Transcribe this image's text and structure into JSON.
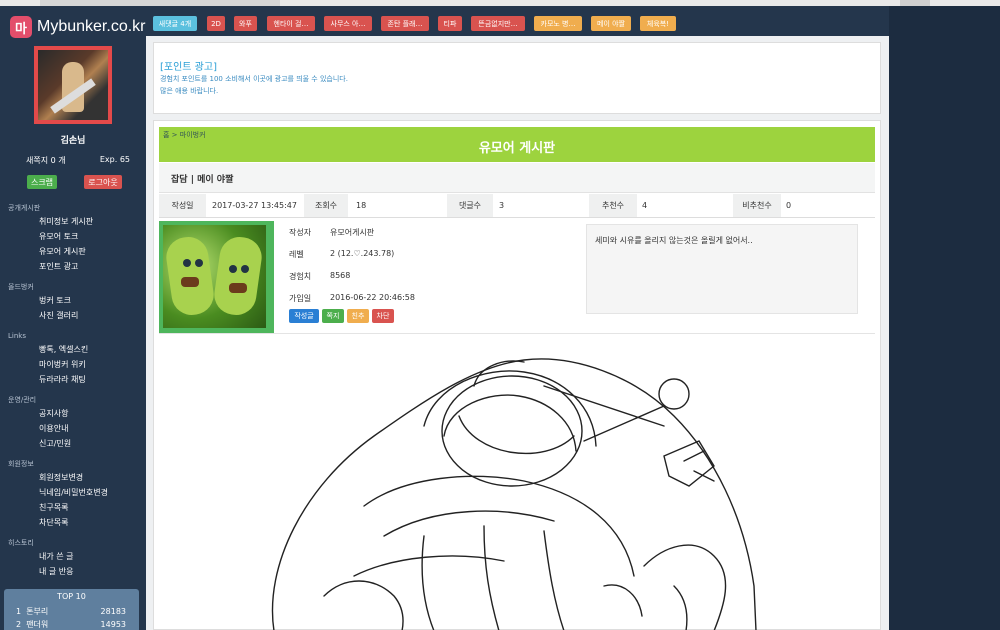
{
  "site": {
    "logo_badge": "마",
    "logo_text": "Mybunker.co.kr"
  },
  "user": {
    "name": "김손님",
    "messages": "새쪽지 0 개",
    "exp": "Exp. 65",
    "scrap_label": "스크랩",
    "logout_label": "로그아웃"
  },
  "menu": {
    "sections": [
      {
        "title": "공개게시판",
        "items": [
          "취미정보 게시판",
          "유모어 토크",
          "유모어 게시판",
          "포인트 광고"
        ]
      },
      {
        "title": "올드벙커",
        "items": [
          "벙커 토크",
          "사진 갤러리"
        ]
      },
      {
        "title": "Links",
        "items": [
          "빵톡, 엑셀스킨",
          "마이벙커 위키",
          "듀라라라 채팅"
        ]
      },
      {
        "title": "운영/관리",
        "items": [
          "공지사항",
          "이용안내",
          "신고/민원"
        ]
      },
      {
        "title": "회원정보",
        "items": [
          "회원정보변경",
          "닉네임/비밀번호변경",
          "친구목록",
          "차단목록"
        ]
      },
      {
        "title": "히스토리",
        "items": [
          "내가 쓴 글",
          "내 글 반응"
        ]
      }
    ]
  },
  "top10": {
    "title": "TOP 10",
    "rows": [
      {
        "rank": "1",
        "name": "톤부리",
        "score": "28183"
      },
      {
        "rank": "2",
        "name": "팬더워",
        "score": "14953"
      }
    ]
  },
  "topbar": {
    "chips": [
      {
        "label": "새댓글 4개",
        "color": "#5bc0de"
      },
      {
        "label": "2D",
        "color": "#d9534f"
      },
      {
        "label": "와푸",
        "color": "#d9534f"
      },
      {
        "label": "헨타이 걸…",
        "color": "#d9534f"
      },
      {
        "label": "사무스 아…",
        "color": "#d9534f"
      },
      {
        "label": "존탄 플래…",
        "color": "#d9534f"
      },
      {
        "label": "티파",
        "color": "#d9534f"
      },
      {
        "label": "뜬금없지만…",
        "color": "#d9534f"
      },
      {
        "label": "카모노 병…",
        "color": "#f0ad4e"
      },
      {
        "label": "메이 야짤",
        "color": "#f0ad4e"
      },
      {
        "label": "체육복!",
        "color": "#f0ad4e"
      }
    ]
  },
  "ad": {
    "title": "[포인트 광고]",
    "line1": "경험치 포인트를 100 소비해서 이곳에 광고를 띄울 수 있습니다.",
    "line2": "많은 애용 바랍니다."
  },
  "board": {
    "breadcrumb": "홈 > 마이벙커",
    "title": "유모어 게시판"
  },
  "post": {
    "title": "잡담 | 메이 야짤",
    "info": {
      "date_label": "작성일",
      "date": "2017-03-27 13:45:47",
      "views_label": "조회수",
      "views": "18",
      "comments_label": "댓글수",
      "comments": "3",
      "up_label": "추천수",
      "up": "4",
      "down_label": "비추천수",
      "down": "0"
    },
    "author": {
      "writer_label": "작성자",
      "writer": "유모어게시판",
      "level_label": "레벨",
      "level": "2 (12.♡.243.78)",
      "exp_label": "경험치",
      "exp": "8568",
      "joined_label": "가입일",
      "joined": "2016-06-22 20:46:58"
    },
    "actions": {
      "posts": "작성글",
      "message": "쪽지",
      "friend": "친추",
      "block": "차단"
    },
    "memo": "세미와 시유를 올리지 않는것은 올릴게 없어서.."
  }
}
